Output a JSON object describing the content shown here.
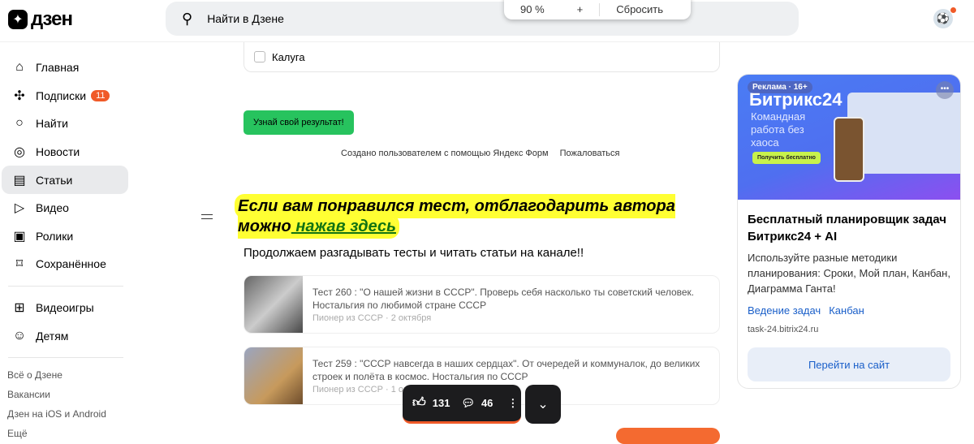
{
  "header": {
    "logo": "дзен",
    "search_placeholder": "Найти в Дзене",
    "zoom_level": "90 %",
    "zoom_plus": "+",
    "zoom_reset": "Сбросить"
  },
  "sidebar": {
    "items": [
      {
        "label": "Главная",
        "icon": "home-icon"
      },
      {
        "label": "Подписки",
        "icon": "subscriptions-icon",
        "badge": "11"
      },
      {
        "label": "Найти",
        "icon": "search-icon"
      },
      {
        "label": "Новости",
        "icon": "news-icon"
      },
      {
        "label": "Статьи",
        "icon": "articles-icon",
        "active": true
      },
      {
        "label": "Видео",
        "icon": "video-icon"
      },
      {
        "label": "Ролики",
        "icon": "shorts-icon"
      },
      {
        "label": "Сохранённое",
        "icon": "bookmark-icon"
      }
    ],
    "items2": [
      {
        "label": "Видеоигры",
        "icon": "gamepad-icon"
      },
      {
        "label": "Детям",
        "icon": "kids-icon"
      }
    ],
    "footer": [
      "Всё о Дзене",
      "Вакансии",
      "Дзен на iOS и Android",
      "Ещё"
    ]
  },
  "main": {
    "checkbox_label": "Калуга",
    "result_button": "Узнай свой результат!",
    "credits": "Создано пользователем с помощью Яндекс Форм",
    "report": "Пожаловаться",
    "highlight_text": "Если вам понравился тест, отблагодарить автора можно",
    "highlight_link": " нажав здесь",
    "continue_text": "Продолжаем разгадывать тесты и читать статьи на канале!!",
    "articles": [
      {
        "title": "Тест 260 : \"О нашей жизни в СССР\". Проверь себя насколько ты советский человек. Ностальгия по любимой стране СССР",
        "meta": "Пионер из СССР · 2 октября"
      },
      {
        "title": "Тест 259 : \"СССР навсегда в наших сердцах\". От очередей и коммуналок, до великих строек и полёта в космос. Ностальгия по СССР",
        "meta": "Пионер из СССР · 1 октября"
      }
    ],
    "likes": "131",
    "comments": "46"
  },
  "ad": {
    "label": "Реклама · 16+",
    "brand": "Битрикс24",
    "image_sub": "Командная работа без хаоса",
    "image_cta": "Получить бесплатно",
    "title": "Бесплатный планировщик задач Битрикс24 + AI",
    "desc": "Используйте разные методики планирования: Сроки, Мой план, Канбан, Диаграмма Ганта!",
    "links": [
      "Ведение задач",
      "Канбан"
    ],
    "domain": "task-24.bitrix24.ru",
    "button": "Перейти на сайт"
  },
  "colors": {
    "accent": "#f05a28",
    "green": "#27c35e",
    "highlight": "#ffff33",
    "link": "#1a5fc9"
  }
}
